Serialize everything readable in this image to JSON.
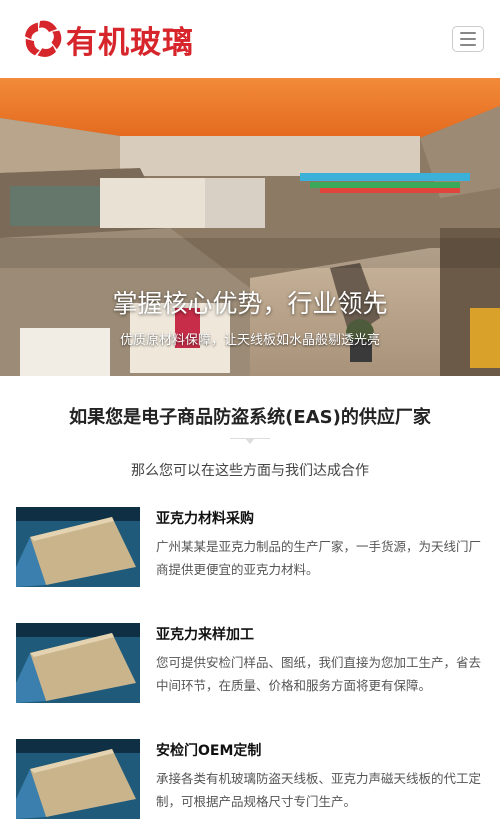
{
  "header": {
    "logo_text": "有机玻璃",
    "menu_icon": "hamburger-menu-icon",
    "brand_color": "#d7262b"
  },
  "banner": {
    "title": "掌握核心优势，行业领先",
    "subtitle": "优质原材料保障，让天线板如水晶般剔透光亮"
  },
  "intro": {
    "title": "如果您是电子商品防盗系统(EAS)的供应厂家",
    "subtitle": "那么您可以在这些方面与我们达成合作"
  },
  "items": [
    {
      "title": "亚克力材料采购",
      "desc": "广州某某是亚克力制品的生产厂家，一手货源，为天线门厂商提供更便宜的亚克力材料。"
    },
    {
      "title": "亚克力来样加工",
      "desc": "您可提供安检门样品、图纸，我们直接为您加工生产，省去中间环节，在质量、价格和服务方面将更有保障。"
    },
    {
      "title": "安检门OEM定制",
      "desc": "承接各类有机玻璃防盗天线板、亚克力声磁天线板的代工定制，可根据产品规格尺寸专门生产。"
    }
  ]
}
